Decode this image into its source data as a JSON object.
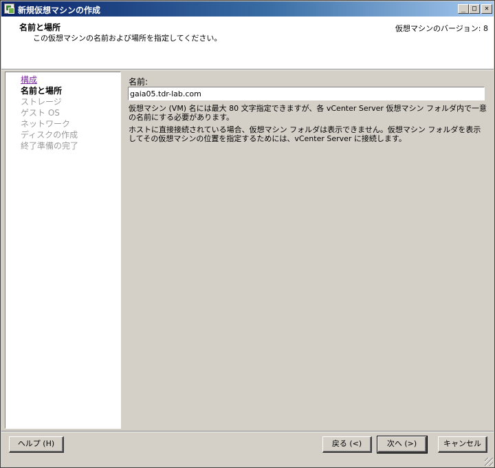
{
  "window": {
    "title": "新規仮想マシンの作成",
    "controls": {
      "minimize": "_",
      "maximize": "□",
      "close": "✕"
    }
  },
  "header": {
    "step_title": "名前と場所",
    "step_description": "この仮想マシンの名前および場所を指定してください。",
    "version": "仮想マシンのバージョン: 8"
  },
  "nav": {
    "items": [
      {
        "label": "構成",
        "state": "visited"
      },
      {
        "label": "名前と場所",
        "state": "current"
      },
      {
        "label": "ストレージ",
        "state": "disabled"
      },
      {
        "label": "ゲスト OS",
        "state": "disabled"
      },
      {
        "label": "ネットワーク",
        "state": "disabled"
      },
      {
        "label": "ディスクの作成",
        "state": "disabled"
      },
      {
        "label": "終了準備の完了",
        "state": "disabled"
      }
    ]
  },
  "main": {
    "name_label": "名前:",
    "name_value": "gaia05.tdr-lab.com",
    "info_1": "仮想マシン (VM) 名には最大 80 文字指定できますが、各 vCenter Server 仮想マシン フォルダ内で一意の名前にする必要があります。",
    "info_2": "ホストに直接接続されている場合、仮想マシン フォルダは表示できません。仮想マシン フォルダを表示してその仮想マシンの位置を指定するためには、vCenter Server に接続します。"
  },
  "buttons": {
    "help": "ヘルプ (H)",
    "back": "戻る (<)",
    "next": "次へ (>)",
    "cancel": "キャンセル"
  },
  "colors": {
    "title_gradient_start": "#0a246a",
    "visited_link": "#7b2aa0",
    "disabled_text": "#9a9a9a",
    "dialog_bg": "#d4d0c8"
  }
}
